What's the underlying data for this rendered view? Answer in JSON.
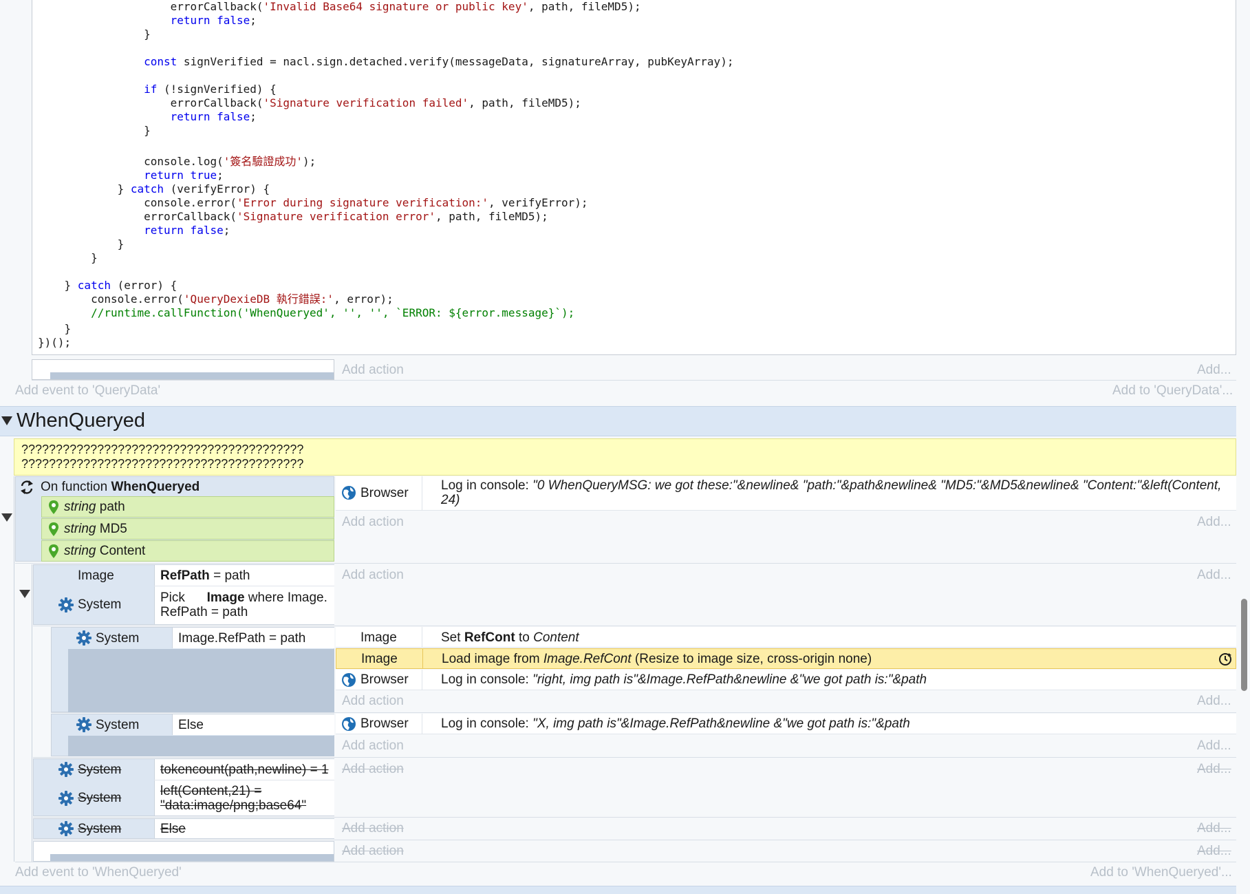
{
  "code": {
    "lines": [
      {
        "indent": "                    ",
        "parts": [
          [
            "errorCallback(",
            ""
          ],
          [
            "'Invalid Base64 signature or public key'",
            "str"
          ],
          [
            ", path, fileMD5);",
            ""
          ]
        ]
      },
      {
        "indent": "                    ",
        "parts": [
          [
            "return false",
            "kw"
          ],
          [
            ";",
            ""
          ]
        ]
      },
      {
        "indent": "                ",
        "parts": [
          [
            "}",
            ""
          ]
        ]
      },
      {
        "indent": "",
        "parts": []
      },
      {
        "indent": "                ",
        "parts": [
          [
            "const",
            "kw"
          ],
          [
            " signVerified = nacl.sign.detached.verify(messageData, signatureArray, pubKeyArray);",
            ""
          ]
        ]
      },
      {
        "indent": "",
        "parts": []
      },
      {
        "indent": "                ",
        "parts": [
          [
            "if",
            "kw"
          ],
          [
            " (!signVerified) {",
            ""
          ]
        ]
      },
      {
        "indent": "                    ",
        "parts": [
          [
            "errorCallback(",
            ""
          ],
          [
            "'Signature verification failed'",
            "str"
          ],
          [
            ", path, fileMD5);",
            ""
          ]
        ]
      },
      {
        "indent": "                    ",
        "parts": [
          [
            "return false",
            "kw"
          ],
          [
            ";",
            ""
          ]
        ]
      },
      {
        "indent": "                ",
        "parts": [
          [
            "}",
            ""
          ]
        ]
      },
      {
        "indent": "",
        "parts": []
      },
      {
        "indent": "                ",
        "parts": [
          [
            "console.log(",
            ""
          ],
          [
            "'簽名驗證成功'",
            "str"
          ],
          [
            ");",
            ""
          ]
        ]
      },
      {
        "indent": "                ",
        "parts": [
          [
            "return true",
            "kw"
          ],
          [
            ";",
            ""
          ]
        ]
      },
      {
        "indent": "            ",
        "parts": [
          [
            "} ",
            ""
          ],
          [
            "catch",
            "kw"
          ],
          [
            " (verifyError) {",
            ""
          ]
        ]
      },
      {
        "indent": "                ",
        "parts": [
          [
            "console.error(",
            ""
          ],
          [
            "'Error during signature verification:'",
            "str"
          ],
          [
            ", verifyError);",
            ""
          ]
        ]
      },
      {
        "indent": "                ",
        "parts": [
          [
            "errorCallback(",
            ""
          ],
          [
            "'Signature verification error'",
            "str"
          ],
          [
            ", path, fileMD5);",
            ""
          ]
        ]
      },
      {
        "indent": "                ",
        "parts": [
          [
            "return false",
            "kw"
          ],
          [
            ";",
            ""
          ]
        ]
      },
      {
        "indent": "            ",
        "parts": [
          [
            "}",
            ""
          ]
        ]
      },
      {
        "indent": "        ",
        "parts": [
          [
            "}",
            ""
          ]
        ]
      },
      {
        "indent": "",
        "parts": []
      },
      {
        "indent": "    ",
        "parts": [
          [
            "} ",
            ""
          ],
          [
            "catch",
            "kw"
          ],
          [
            " (error) {",
            ""
          ]
        ]
      },
      {
        "indent": "        ",
        "parts": [
          [
            "console.error(",
            ""
          ],
          [
            "'QueryDexieDB 執行錯誤:'",
            "str"
          ],
          [
            ", error);",
            ""
          ]
        ]
      },
      {
        "indent": "        ",
        "parts": [
          [
            "//runtime.callFunction('WhenQueryed', '', '', `ERROR: ${error.message}`);",
            "cm"
          ]
        ]
      },
      {
        "indent": "    ",
        "parts": [
          [
            "}",
            ""
          ]
        ]
      },
      {
        "indent": "",
        "parts": [
          [
            "})();",
            ""
          ]
        ]
      }
    ]
  },
  "querydata": {
    "add_action": "Add action",
    "add_action_right": "Add...",
    "add_event": "Add event to 'QueryData'",
    "add_to": "Add to 'QueryData'..."
  },
  "group": {
    "title": "WhenQueryed",
    "comment_1": "?????????????????????????????????????????",
    "comment_2": "?????????????????????????????????????????"
  },
  "func": {
    "prefix": "On function ",
    "name": "WhenQueryed",
    "params": [
      {
        "type": "string",
        "name": "path"
      },
      {
        "type": "string",
        "name": "MD5"
      },
      {
        "type": "string",
        "name": "Content"
      }
    ],
    "action_object": "Browser",
    "action_prefix": "Log in console: ",
    "action_text": "\"0 WhenQueryMSG: we got these:\"&newline& \"path:\"&path&newline& \"MD5:\"&MD5&newline& \"Content:\"&left(Content, 24)"
  },
  "ev2": {
    "c1_object": "Image",
    "c1_bold": "RefPath",
    "c1_rest": " = path",
    "c2_object": "System",
    "c2_text1": "Pick",
    "c2_bold": "Image",
    "c2_text2": " where Image.",
    "c2_text3": "RefPath = path"
  },
  "ev3": {
    "cond_object": "System",
    "cond_text": "Image.RefPath = path",
    "a1_object": "Image",
    "a1_prefix": "Set ",
    "a1_bold": "RefCont",
    "a1_mid": " to ",
    "a1_italic": "Content",
    "a2_object": "Image",
    "a2_prefix": "Load image from ",
    "a2_italic": "Image.RefCont",
    "a2_rest": " (Resize to image size, cross-origin none)",
    "a3_object": "Browser",
    "a3_prefix": "Log in console: ",
    "a3_text": "\"right, img path is\"&Image.RefPath&newline &\"we got path is:\"&path"
  },
  "ev4": {
    "cond_object": "System",
    "cond_text": "Else",
    "a1_object": "Browser",
    "a1_prefix": "Log in console: ",
    "a1_text": "\"X, img path is\"&Image.RefPath&newline &\"we got path is:\"&path"
  },
  "ev5": {
    "c1_object": "System",
    "c1_text": "tokencount(path,newline) = 1",
    "c2_object": "System",
    "c2_text1": "left(Content,21) =",
    "c2_text2": "\"data:image/png;base64\""
  },
  "ev6": {
    "cond_object": "System",
    "cond_text": "Else"
  },
  "common": {
    "add_action": "Add action",
    "add_right": "Add..."
  },
  "footer": {
    "add_event": "Add event to 'WhenQueryed'",
    "add_to": "Add to 'WhenQueryed'..."
  },
  "colors": {
    "group_header": "#dbe7f5",
    "comment": "#ffffc0",
    "param": "#dcf0b8",
    "highlight": "#fdeea8"
  }
}
